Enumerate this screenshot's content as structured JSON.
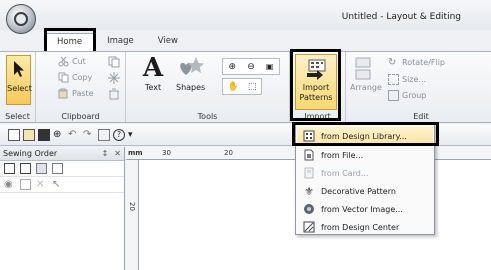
{
  "window": {
    "title": "Untitled - Layout & Editing"
  },
  "ribbon_tabs": [
    {
      "label": "Home"
    },
    {
      "label": "Image"
    },
    {
      "label": "View"
    }
  ],
  "ribbon": {
    "select": {
      "label": "Select"
    },
    "clipboard": {
      "cut": "Cut",
      "copy": "Copy",
      "paste": "Paste",
      "group_label": "Clipboard"
    },
    "tools": {
      "text": "Text",
      "shapes": "Shapes",
      "group_label": "Tools"
    },
    "import": {
      "label_line1": "Import",
      "label_line2": "Patterns",
      "group_label": "Import"
    },
    "edit": {
      "arrange": "Arrange",
      "rotate_flip": "Rotate/Flip",
      "size": "Size...",
      "group": "Group",
      "group_label": "Edit"
    },
    "select_group_label": "Select"
  },
  "panel": {
    "title": "Sewing Order",
    "pin": "↕",
    "close": "✕"
  },
  "ruler": {
    "unit": "mm",
    "top_marks": [
      "30",
      "20"
    ],
    "left_marks": [
      "20"
    ]
  },
  "import_menu": {
    "items": [
      {
        "label": "from Design Library...",
        "enabled": true,
        "icon": "design-library-icon"
      },
      {
        "label": "from File...",
        "enabled": true,
        "icon": "file-icon"
      },
      {
        "label": "from Card...",
        "enabled": false,
        "icon": "card-icon"
      },
      {
        "label": "Decorative Pattern",
        "enabled": true,
        "icon": "decorative-pattern-icon"
      },
      {
        "label": "from Vector Image...",
        "enabled": true,
        "icon": "vector-image-icon"
      },
      {
        "label": "from Design Center",
        "enabled": true,
        "icon": "design-center-icon"
      }
    ]
  },
  "colors": {
    "accent": "#f7c95a",
    "highlight_border": "#000000"
  }
}
